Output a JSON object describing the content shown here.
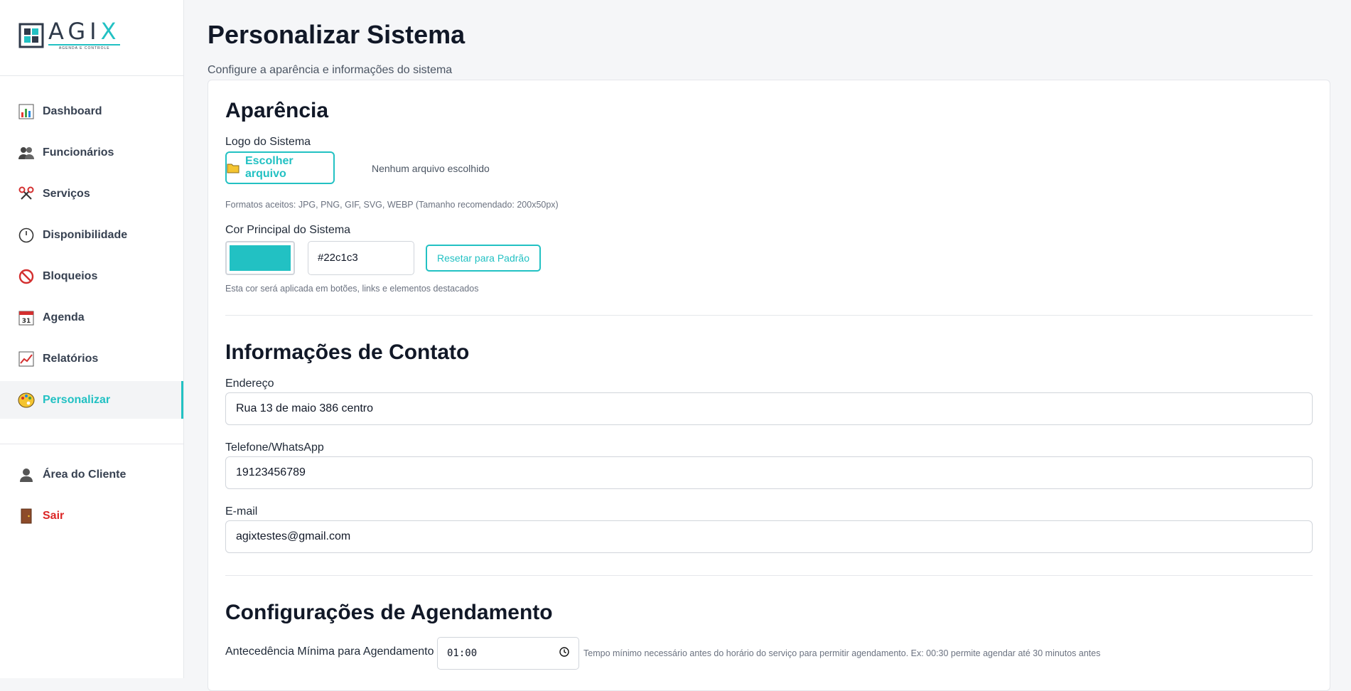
{
  "brand": {
    "name_main": "AGI",
    "name_accent": "X",
    "tagline": "AGENDA E CONTROLE"
  },
  "sidebar": {
    "items": [
      {
        "label": "Dashboard",
        "icon": "bar-chart-icon"
      },
      {
        "label": "Funcionários",
        "icon": "users-icon"
      },
      {
        "label": "Serviços",
        "icon": "scissors-icon"
      },
      {
        "label": "Disponibilidade",
        "icon": "clock-icon"
      },
      {
        "label": "Bloqueios",
        "icon": "prohibited-icon"
      },
      {
        "label": "Agenda",
        "icon": "calendar-icon"
      },
      {
        "label": "Relatórios",
        "icon": "line-chart-icon"
      },
      {
        "label": "Personalizar",
        "icon": "palette-icon",
        "active": true
      }
    ],
    "bottom_items": [
      {
        "label": "Área do Cliente",
        "icon": "client-icon"
      },
      {
        "label": "Sair",
        "icon": "door-icon"
      }
    ],
    "calendar_day": "31"
  },
  "page": {
    "title": "Personalizar Sistema",
    "subtitle": "Configure a aparência e informações do sistema"
  },
  "appearance": {
    "title": "Aparência",
    "logo_label": "Logo do Sistema",
    "file_button": "Escolher arquivo",
    "file_status": "Nenhum arquivo escolhido",
    "formats_hint": "Formatos aceitos: JPG, PNG, GIF, SVG, WEBP (Tamanho recomendado: 200x50px)",
    "color_label": "Cor Principal do Sistema",
    "color_value": "#22c1c3",
    "reset_button": "Resetar para Padrão",
    "color_hint": "Esta cor será aplicada em botões, links e elementos destacados"
  },
  "contact": {
    "title": "Informações de Contato",
    "address_label": "Endereço",
    "address_value": "Rua 13 de maio 386 centro",
    "phone_label": "Telefone/WhatsApp",
    "phone_value": "19123456789",
    "email_label": "E-mail",
    "email_value": "agixtestes@gmail.com"
  },
  "scheduling": {
    "title": "Configurações de Agendamento",
    "advance_label": "Antecedência Mínima para Agendamento",
    "advance_value": "01:00",
    "advance_hint": "Tempo mínimo necessário antes do horário do serviço para permitir agendamento. Ex: 00:30 permite agendar até 30 minutos antes"
  },
  "colors": {
    "accent": "#22c1c3",
    "danger": "#dc2626",
    "text": "#1f2937"
  }
}
